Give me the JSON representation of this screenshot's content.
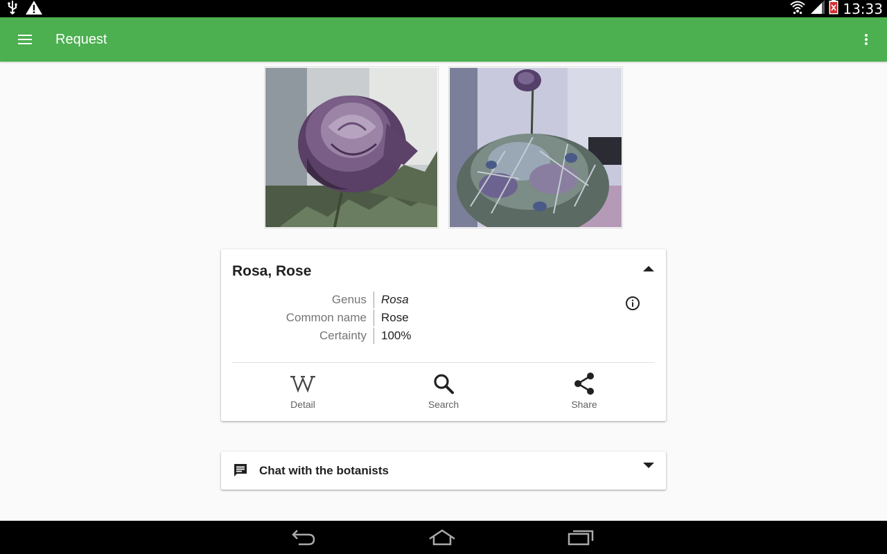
{
  "status_bar": {
    "time": "13:33"
  },
  "app_bar": {
    "title": "Request"
  },
  "photos": [
    {
      "subject": "purple rose close-up"
    },
    {
      "subject": "dried flower bouquet"
    }
  ],
  "result": {
    "title": "Rosa, Rose",
    "rows": [
      {
        "label": "Genus",
        "value": "Rosa"
      },
      {
        "label": "Common name",
        "value": "Rose"
      },
      {
        "label": "Certainty",
        "value": "100%"
      }
    ],
    "actions": [
      {
        "label": "Detail",
        "icon": "wikipedia-icon"
      },
      {
        "label": "Search",
        "icon": "search-icon"
      },
      {
        "label": "Share",
        "icon": "share-icon"
      }
    ]
  },
  "chat": {
    "title": "Chat with the botanists"
  },
  "colors": {
    "app_bar": "#4caf50",
    "background": "#fafafa",
    "system_bars": "#000000"
  }
}
